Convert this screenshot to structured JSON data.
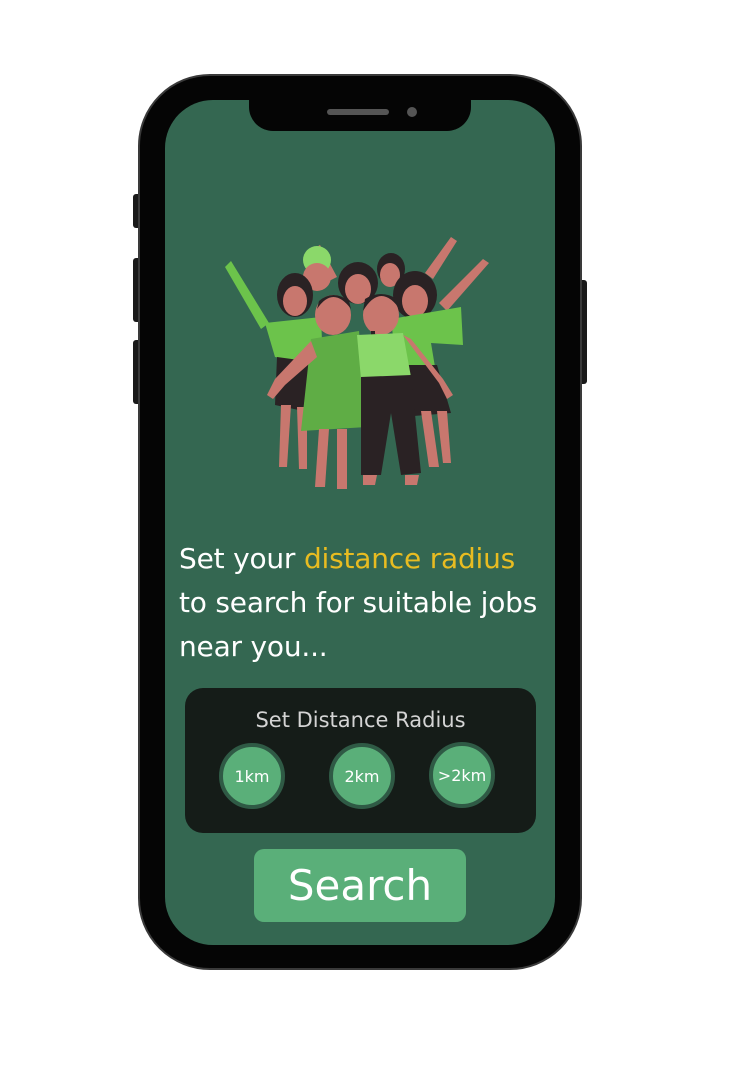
{
  "headline": {
    "prefix": "Set your ",
    "accent": "distance radius",
    "suffix": " to search for suitable jobs near you..."
  },
  "radius_selector": {
    "title": "Set Distance Radius",
    "options": [
      "1km",
      "2km",
      ">2km"
    ]
  },
  "search_button": {
    "label": "Search"
  },
  "colors": {
    "screen_background": "#346751",
    "accent_text": "#E8BC21",
    "button_green": "#5AAF79",
    "card_background": "#151c18",
    "phone_frame": "#050505"
  },
  "icons": {
    "illustration": "group-of-people-cheering-illustration"
  }
}
